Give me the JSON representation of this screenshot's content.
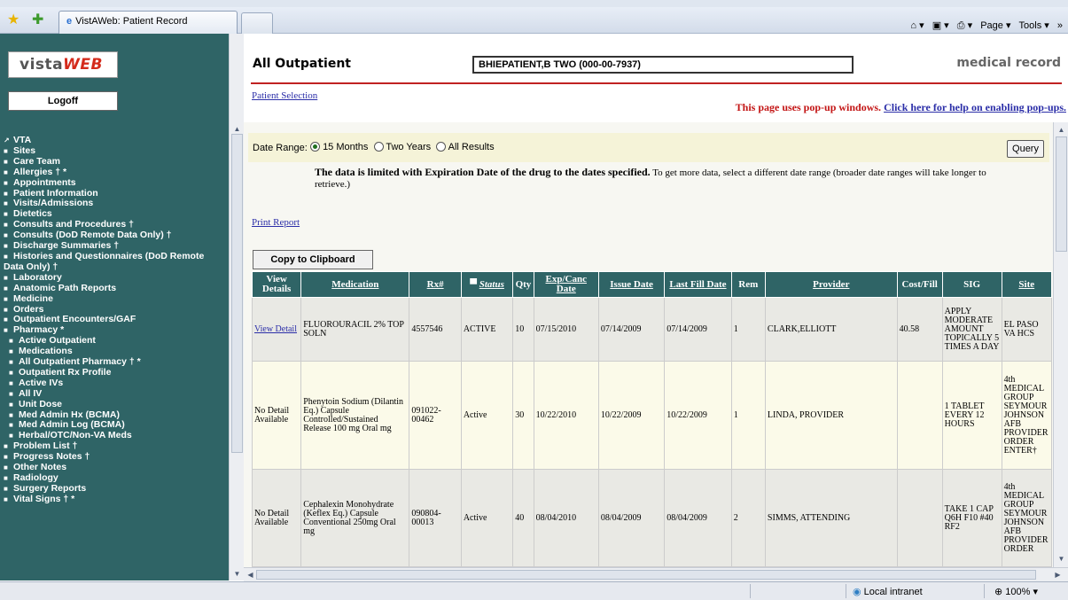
{
  "browser": {
    "tab_title": "VistAWeb: Patient Record",
    "commands": {
      "home": "⌂ ▾",
      "feeds": "▣ ▾",
      "print": "⎙ ▾",
      "page": "Page ▾",
      "tools": "Tools ▾",
      "more": "»"
    }
  },
  "nav": {
    "logo_prefix": "vista",
    "logo_suffix": "WEB",
    "logoff": "Logoff",
    "items": [
      {
        "label": "VTA",
        "bullet": "↗"
      },
      {
        "label": "Sites",
        "bullet": "■"
      },
      {
        "label": "Care Team",
        "bullet": "■"
      },
      {
        "label": "Allergies † *",
        "bullet": "■"
      },
      {
        "label": "Appointments",
        "bullet": "■"
      },
      {
        "label": "Patient Information",
        "bullet": "■"
      },
      {
        "label": "Visits/Admissions",
        "bullet": "■"
      },
      {
        "label": "Dietetics",
        "bullet": "■"
      },
      {
        "label": "Consults and Procedures †",
        "bullet": "■"
      },
      {
        "label": "Consults (DoD Remote Data Only) †",
        "bullet": "■"
      },
      {
        "label": "Discharge Summaries †",
        "bullet": "■"
      },
      {
        "label": "Histories and Questionnaires (DoD Remote Data Only) †",
        "bullet": "■"
      },
      {
        "label": "Laboratory",
        "bullet": "■"
      },
      {
        "label": "Anatomic Path Reports",
        "bullet": "■"
      },
      {
        "label": "Medicine",
        "bullet": "■"
      },
      {
        "label": "Orders",
        "bullet": "■"
      },
      {
        "label": "Outpatient Encounters/GAF",
        "bullet": "■"
      },
      {
        "label": "Pharmacy *",
        "bullet": "■"
      },
      {
        "label": "Active Outpatient",
        "bullet": "■"
      },
      {
        "label": "Medications",
        "bullet": "■"
      },
      {
        "label": "All Outpatient Pharmacy † *",
        "bullet": "■"
      },
      {
        "label": "Outpatient Rx Profile",
        "bullet": "■"
      },
      {
        "label": "Active IVs",
        "bullet": "■"
      },
      {
        "label": "All IV",
        "bullet": "■"
      },
      {
        "label": "Unit Dose",
        "bullet": "■"
      },
      {
        "label": "Med Admin Hx (BCMA)",
        "bullet": "■"
      },
      {
        "label": "Med Admin Log (BCMA)",
        "bullet": "■"
      },
      {
        "label": "Herbal/OTC/Non-VA Meds",
        "bullet": "■"
      },
      {
        "label": "Problem List †",
        "bullet": "■"
      },
      {
        "label": "Progress Notes †",
        "bullet": "■"
      },
      {
        "label": "Other Notes",
        "bullet": "■"
      },
      {
        "label": "Radiology",
        "bullet": "■"
      },
      {
        "label": "Surgery Reports",
        "bullet": "■"
      },
      {
        "label": "Vital Signs † *",
        "bullet": "■"
      }
    ]
  },
  "header": {
    "title": "All Outpatient",
    "patient": "BHIEPATIENT,B TWO (000-00-7937)",
    "right_label": "medical record",
    "patient_selection": "Patient Selection",
    "popup_note": "This page uses pop-up windows.",
    "popup_link": "Click here for help on enabling pop-ups."
  },
  "daterange": {
    "label": "Date Range:",
    "options": [
      "15 Months",
      "Two Years",
      "All Results"
    ],
    "selected": "15 Months",
    "query": "Query"
  },
  "limit_note": {
    "bold": "The data is limited with Expiration Date of the drug to the dates specified.",
    "rest": " To get more data, select a different date range (broader date ranges will take longer to retrieve.)"
  },
  "print_report": "Print Report",
  "copy_clipboard": "Copy to Clipboard",
  "table": {
    "headers": [
      "View Details",
      "Medication",
      "Rx#",
      "Status",
      "Qty",
      "Exp/Canc Date",
      "Issue Date",
      "Last Fill Date",
      "Rem",
      "Provider",
      "Cost/Fill",
      "SIG",
      "Site"
    ],
    "rows": [
      [
        "View Detail",
        "FLUOROURACIL 2% TOP SOLN",
        "4557546",
        "ACTIVE",
        "10",
        "07/15/2010",
        "07/14/2009",
        "07/14/2009",
        "1",
        "CLARK,ELLIOTT",
        "40.58",
        "APPLY MODERATE AMOUNT TOPICALLY 5 TIMES A DAY",
        "EL PASO VA HCS"
      ],
      [
        "No Detail Available",
        "Phenytoin Sodium (Dilantin Eq.) Capsule Controlled/Sustained Release 100 mg Oral mg",
        "091022-00462",
        "Active",
        "30",
        "10/22/2010",
        "10/22/2009",
        "10/22/2009",
        "1",
        "LINDA, PROVIDER",
        "",
        "1 TABLET EVERY 12 HOURS",
        "4th MEDICAL GROUP SEYMOUR JOHNSON AFB PROVIDER ORDER ENTER†"
      ],
      [
        "No Detail Available",
        "Cephalexin Monohydrate (Keflex Eq.) Capsule Conventional 250mg Oral mg",
        "090804-00013",
        "Active",
        "40",
        "08/04/2010",
        "08/04/2009",
        "08/04/2009",
        "2",
        "SIMMS, ATTENDING",
        "",
        "TAKE 1 CAP Q6H F10 #40 RF2",
        "4th MEDICAL GROUP SEYMOUR JOHNSON AFB PROVIDER ORDER"
      ]
    ]
  },
  "statusbar": {
    "zone": "Local intranet",
    "zoom": "100%"
  }
}
